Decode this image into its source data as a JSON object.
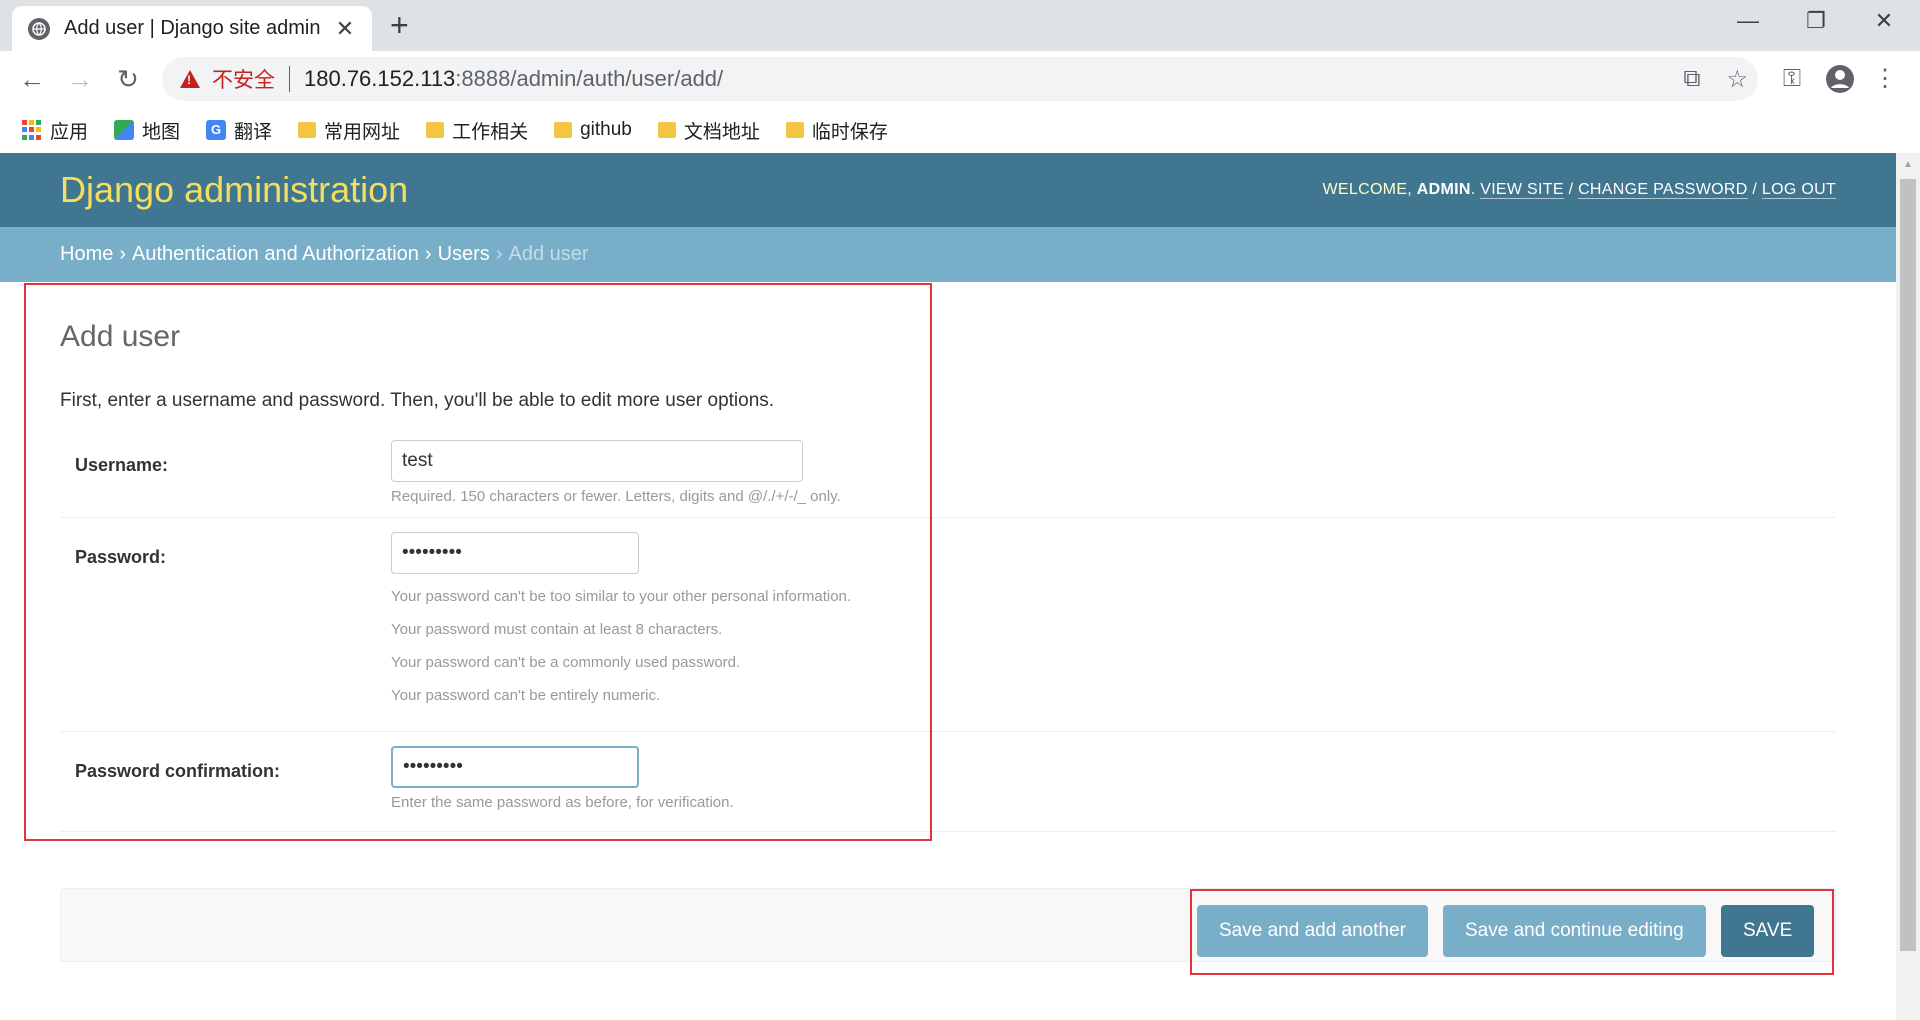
{
  "browser": {
    "tab_title": "Add user | Django site admin",
    "insecure_label": "不安全",
    "url_host": "180.76.152.113",
    "url_path": ":8888/admin/auth/user/add/",
    "bookmarks": [
      "应用",
      "地图",
      "翻译",
      "常用网址",
      "工作相关",
      "github",
      "文档地址",
      "临时保存"
    ]
  },
  "header": {
    "branding": "Django administration",
    "welcome": "WELCOME, ",
    "username": "ADMIN",
    "view_site": "VIEW SITE",
    "change_password": "CHANGE PASSWORD",
    "log_out": "LOG OUT"
  },
  "breadcrumbs": {
    "home": "Home",
    "app": "Authentication and Authorization",
    "model": "Users",
    "current": "Add user"
  },
  "main": {
    "title": "Add user",
    "intro": "First, enter a username and password. Then, you'll be able to edit more user options.",
    "username": {
      "label": "Username:",
      "value": "test",
      "help": "Required. 150 characters or fewer. Letters, digits and @/./+/-/_ only."
    },
    "password": {
      "label": "Password:",
      "value": "•••••••••",
      "help": [
        "Your password can't be too similar to your other personal information.",
        "Your password must contain at least 8 characters.",
        "Your password can't be a commonly used password.",
        "Your password can't be entirely numeric."
      ]
    },
    "password_confirm": {
      "label": "Password confirmation:",
      "value": "•••••••••",
      "help": "Enter the same password as before, for verification."
    }
  },
  "submit": {
    "save_add_another": "Save and add another",
    "save_continue": "Save and continue editing",
    "save": "SAVE"
  },
  "colors": {
    "header_bg": "#417690",
    "branding": "#f5dd5d",
    "breadcrumbs_bg": "#79aec8",
    "button": "#79aec8",
    "button_default": "#417690",
    "annotation_box": "#e53238"
  }
}
